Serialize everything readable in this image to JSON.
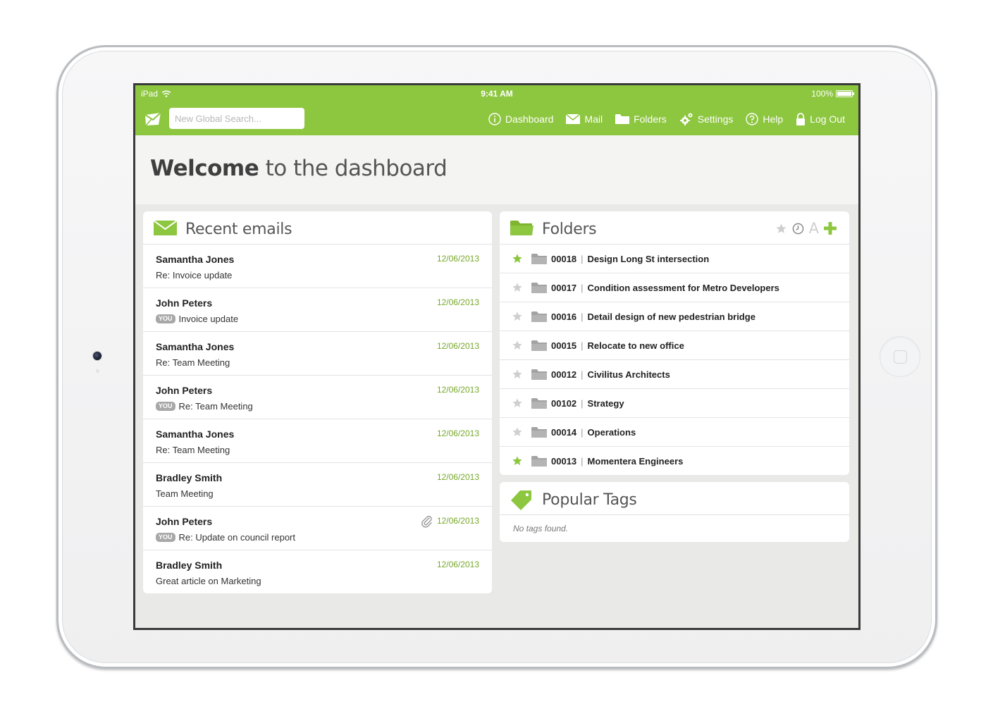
{
  "status_bar": {
    "device": "iPad",
    "time": "9:41 AM",
    "battery": "100%"
  },
  "nav": {
    "search_placeholder": "New Global Search...",
    "items": [
      {
        "label": "Dashboard",
        "icon": "info-icon"
      },
      {
        "label": "Mail",
        "icon": "envelope-icon"
      },
      {
        "label": "Folders",
        "icon": "folder-icon"
      },
      {
        "label": "Settings",
        "icon": "gears-icon"
      },
      {
        "label": "Help",
        "icon": "question-icon"
      },
      {
        "label": "Log Out",
        "icon": "lock-icon"
      }
    ]
  },
  "welcome": {
    "bold": "Welcome",
    "rest": " to the dashboard"
  },
  "emails": {
    "title": "Recent emails",
    "items": [
      {
        "sender": "Samantha Jones",
        "you": "",
        "subject": "Re: Invoice update",
        "date": "12/06/2013"
      },
      {
        "sender": "John Peters",
        "you": "YOU",
        "subject": "Invoice update",
        "date": "12/06/2013"
      },
      {
        "sender": "Samantha Jones",
        "you": "",
        "subject": "Re: Team Meeting",
        "date": "12/06/2013"
      },
      {
        "sender": "John Peters",
        "you": "YOU",
        "subject": "Re: Team Meeting",
        "date": "12/06/2013"
      },
      {
        "sender": "Samantha Jones",
        "you": "",
        "subject": "Re: Team Meeting",
        "date": "12/06/2013"
      },
      {
        "sender": "Bradley Smith",
        "you": "",
        "subject": "Team Meeting",
        "date": "12/06/2013"
      },
      {
        "sender": "John Peters",
        "you": "YOU",
        "subject": "Re: Update on council report",
        "date": "12/06/2013",
        "attachment": true
      },
      {
        "sender": "Bradley Smith",
        "you": "",
        "subject": "Great article on Marketing",
        "date": "12/06/2013"
      }
    ]
  },
  "folders": {
    "title": "Folders",
    "actions": [
      "star-icon",
      "clock-icon",
      "alpha-sort-icon",
      "add-icon"
    ],
    "sort_letter": "A",
    "items": [
      {
        "code": "00018",
        "name": "Design Long St intersection",
        "starred": true
      },
      {
        "code": "00017",
        "name": "Condition assessment for Metro Developers",
        "starred": false
      },
      {
        "code": "00016",
        "name": "Detail design of new pedestrian bridge",
        "starred": false
      },
      {
        "code": "00015",
        "name": "Relocate to new office",
        "starred": false
      },
      {
        "code": "00012",
        "name": "Civilitus Architects",
        "starred": false
      },
      {
        "code": "00102",
        "name": "Strategy",
        "starred": false
      },
      {
        "code": "00014",
        "name": "Operations",
        "starred": false
      },
      {
        "code": "00013",
        "name": "Momentera Engineers",
        "starred": true
      }
    ]
  },
  "tags": {
    "title": "Popular Tags",
    "empty_text": "No tags found."
  },
  "colors": {
    "accent": "#8dc63f",
    "date_green": "#77a82a",
    "star_off": "#cfcfcf",
    "folder_gray": "#a3a3a3"
  }
}
